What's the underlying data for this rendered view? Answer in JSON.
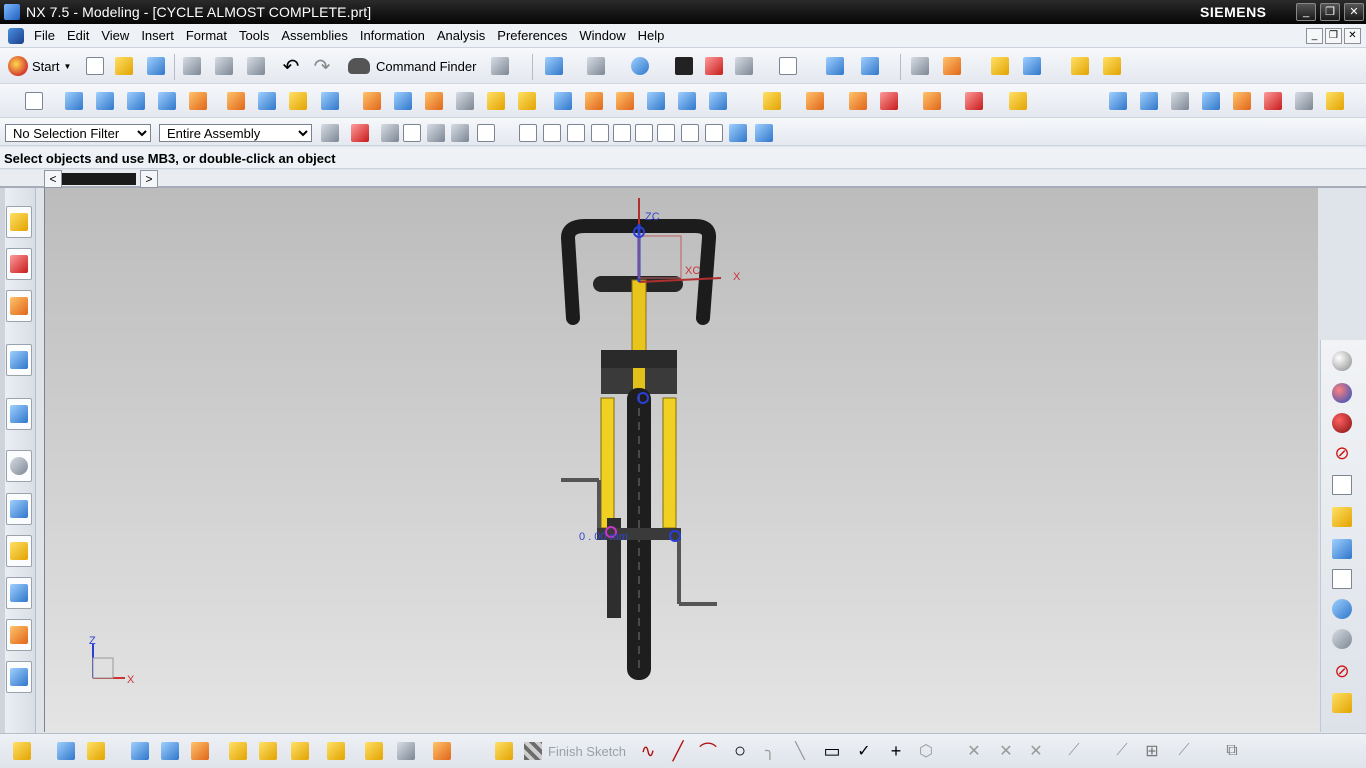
{
  "window": {
    "title": "NX 7.5 - Modeling - [CYCLE ALMOST COMPLETE.prt]",
    "brand": "SIEMENS",
    "controls": [
      "_",
      "❐",
      "✕"
    ]
  },
  "menu": {
    "items": [
      "File",
      "Edit",
      "View",
      "Insert",
      "Format",
      "Tools",
      "Assemblies",
      "Information",
      "Analysis",
      "Preferences",
      "Window",
      "Help"
    ],
    "mdi_controls": [
      "_",
      "❐",
      "✕"
    ]
  },
  "toolbar": {
    "start_label": "Start",
    "command_finder_label": "Command Finder"
  },
  "selection": {
    "filter_value": "No Selection Filter",
    "scope_value": "Entire Assembly"
  },
  "prompt": {
    "text": "Select objects and use MB3, or double-click an object"
  },
  "sketch_toolbar": {
    "finish_sketch_label": "Finish Sketch"
  },
  "viewport": {
    "wcs_labels": {
      "zc": "ZC",
      "xc": "XC",
      "x": "X"
    },
    "triad_labels": {
      "z": "Z",
      "x": "X"
    },
    "dimension_text": "0 . 00 mm",
    "colors": {
      "background_top": "#bcbcbc",
      "background_bottom": "#e4e4e4",
      "frame": "#f2d62a",
      "rubber": "#222222"
    }
  },
  "colors": {
    "title_bar": "#111111",
    "menu_bg": "#eef1f6",
    "accent_blue": "#2f76c9"
  }
}
